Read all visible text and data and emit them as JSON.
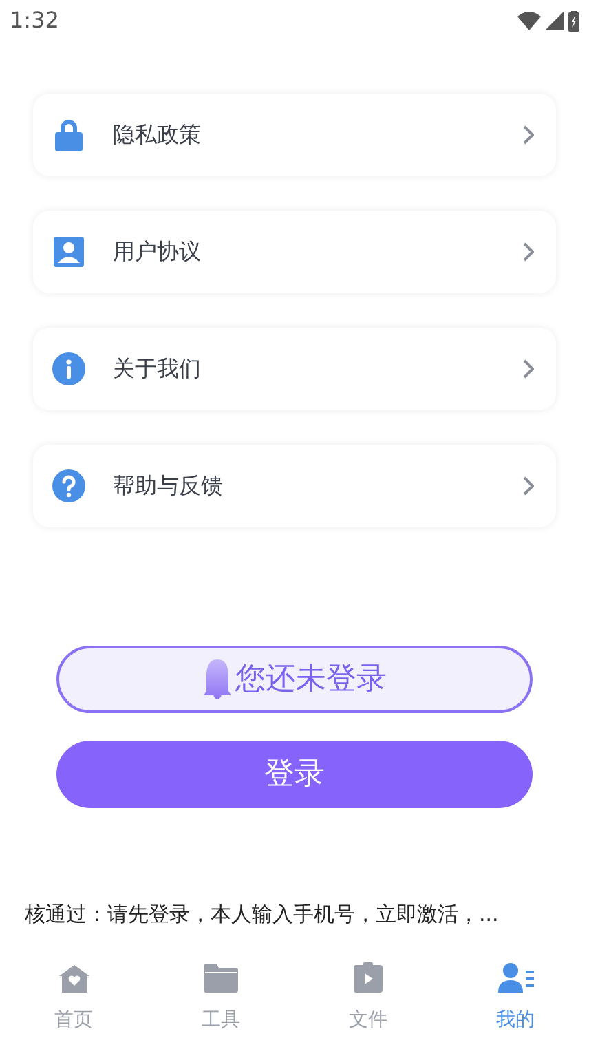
{
  "status_bar": {
    "time": "1:32"
  },
  "menu": [
    {
      "kind": "lock",
      "label": "隐私政策"
    },
    {
      "kind": "user",
      "label": "用户协议"
    },
    {
      "kind": "info",
      "label": "关于我们"
    },
    {
      "kind": "help",
      "label": "帮助与反馈"
    }
  ],
  "login_hint": "您还未登录",
  "login_button": "登录",
  "notice": "核通过：请先登录，本人输入手机号，立即激活，...",
  "tab_bar": [
    {
      "kind": "home",
      "label": "首页",
      "selected": false
    },
    {
      "kind": "tools",
      "label": "工具",
      "selected": false
    },
    {
      "kind": "files",
      "label": "文件",
      "selected": false
    },
    {
      "kind": "mine",
      "label": "我的",
      "selected": true
    }
  ]
}
